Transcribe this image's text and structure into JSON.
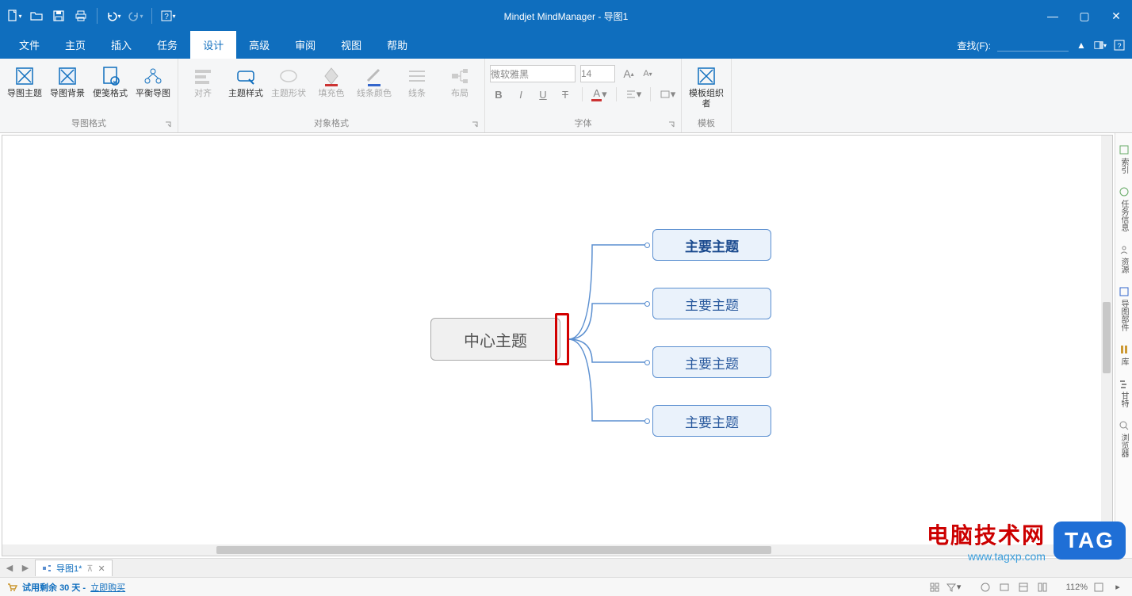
{
  "app": {
    "title": "Mindjet MindManager - 导图1"
  },
  "qat": {
    "new": "新建",
    "open": "打开",
    "save": "保存",
    "print": "打印",
    "undo": "撤销",
    "redo": "重做",
    "help": "?"
  },
  "menu": {
    "tabs": [
      "文件",
      "主页",
      "插入",
      "任务",
      "设计",
      "高级",
      "审阅",
      "视图",
      "帮助"
    ],
    "active_index": 4,
    "find_label": "查找(F):"
  },
  "ribbon": {
    "groups": {
      "map_format": {
        "label": "导图格式",
        "items": {
          "map_theme": "导图主题",
          "map_background": "导图背景",
          "note_format": "便笺格式",
          "balance_map": "平衡导图"
        }
      },
      "object_format": {
        "label": "对象格式",
        "items": {
          "align": "对齐",
          "topic_style": "主题样式",
          "topic_shape": "主题形状",
          "fill_color": "填充色",
          "line_color": "线条颜色",
          "line": "线条",
          "layout": "布局"
        }
      },
      "font": {
        "label": "字体",
        "font_name": "微软雅黑",
        "font_size": "14",
        "grow": "A",
        "shrink": "A",
        "bold": "B",
        "italic": "I",
        "underline": "U",
        "strike": "T",
        "font_color": "A"
      },
      "template": {
        "label": "模板",
        "items": {
          "template_organizer": "模板组织者"
        }
      }
    }
  },
  "mindmap": {
    "central": "中心主题",
    "topics": [
      "主要主题",
      "主要主题",
      "主要主题",
      "主要主题"
    ]
  },
  "side_tabs": [
    "索引",
    "任务信息",
    "资源",
    "导图部件",
    "库",
    "甘特",
    "浏览器"
  ],
  "doc_tab": {
    "name": "导图1*",
    "nav_prev": "◀",
    "nav_next": "▶"
  },
  "status": {
    "trial_prefix": "试用剩余",
    "trial_days": "30",
    "trial_suffix": "天 -",
    "buy_now": "立即购买",
    "zoom": "112%"
  },
  "watermark": {
    "cn": "电脑技术网",
    "url": "www.tagxp.com",
    "badge": "TAG"
  }
}
